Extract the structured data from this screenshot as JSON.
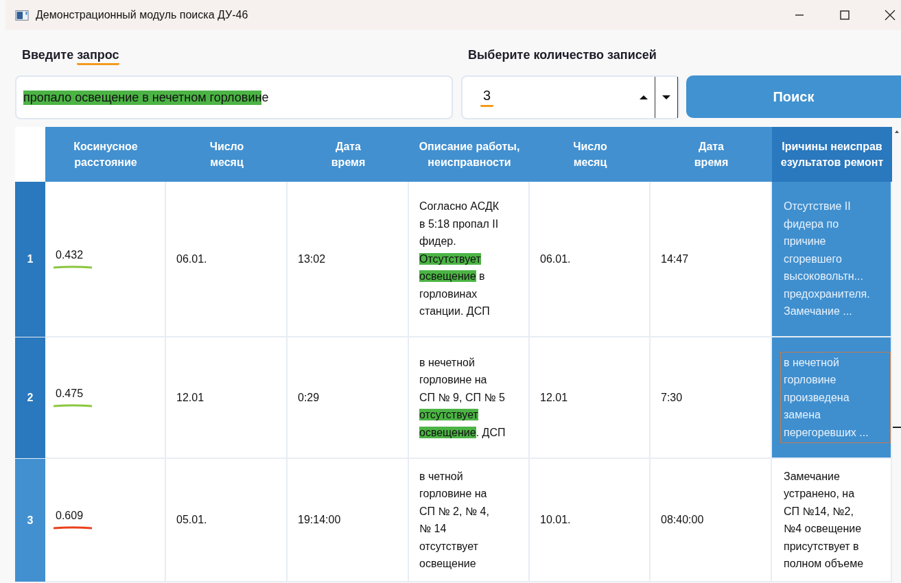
{
  "window": {
    "title": "Демонстрационный модуль поиска ДУ-46"
  },
  "query": {
    "label": [
      {
        "text": "Введите ",
        "underlined": false
      },
      {
        "text": "запрос",
        "underlined": true
      }
    ],
    "value": [
      {
        "text": "пропало освещение в нечетном горловин",
        "highlighted": true
      },
      {
        "text": "е",
        "highlighted": false
      }
    ]
  },
  "count": {
    "label": "Выберите количество записей",
    "value": "3",
    "underlined": true
  },
  "search_button": "Поиск",
  "table": {
    "columns": [
      {
        "label": "Косинусное\nрасстояние",
        "selected": false
      },
      {
        "label": "Число\nмесяц",
        "selected": false
      },
      {
        "label": "Дата\nвремя",
        "selected": false
      },
      {
        "label": "Описание работы,\nнеисправности",
        "selected": false
      },
      {
        "label": "Число\nмесяц",
        "selected": false
      },
      {
        "label": "Дата\nвремя",
        "selected": false
      },
      {
        "label": "Iричины неисправ\nезультатов ремонт",
        "selected": true
      }
    ],
    "rows": [
      {
        "number": "1",
        "selected": true,
        "focused": false,
        "distance": "0.432",
        "color": "#8cc63f",
        "date1": "06.01.",
        "time1": "13:02",
        "description": [
          {
            "text": "Согласно АСДК\nв 5:18 пропал II\nфидер.\n",
            "highlighted": false
          },
          {
            "text": "Отсутствует\nосвещение",
            "highlighted": true
          },
          {
            "text": " в\nгорловинах\nстанции. ДСП",
            "highlighted": false
          }
        ],
        "date2": "06.01.",
        "time2": "14:47",
        "reason": "Отсутствие  II\nфидера по\nпричине\nсгоревшего\nвысоковольтн...\nпредохранителя.\nЗамечание ..."
      },
      {
        "number": "2",
        "selected": true,
        "focused": true,
        "distance": "0.475",
        "color": "#8cc63f",
        "date1": "12.01",
        "time1": "0:29",
        "description": [
          {
            "text": "в нечетной\nгорловине на\nСП № 9, СП № 5\n",
            "highlighted": false
          },
          {
            "text": "отсутствует\nосвещение",
            "highlighted": true
          },
          {
            "text": ". ДСП",
            "highlighted": false
          }
        ],
        "date2": "12.01",
        "time2": "7:30",
        "reason": "в нечетной\nгорловине\nпроизведена\nзамена\nперегоревших ..."
      },
      {
        "number": "3",
        "selected": false,
        "focused": false,
        "distance": "0.609",
        "color": "#e8401c",
        "date1": "05.01.",
        "time1": "19:14:00",
        "description": [
          {
            "text": "в четной\nгорловине на\nСП  № 2, № 4,\n№ 14\nотсутствует\nосвещение",
            "highlighted": false
          }
        ],
        "date2": "10.01.",
        "time2": "08:40:00",
        "reason": "Замечание\nустранено, на\nСП №14, №2,\n№4 освещение\nприсутствует в\nполном объеме"
      }
    ]
  }
}
